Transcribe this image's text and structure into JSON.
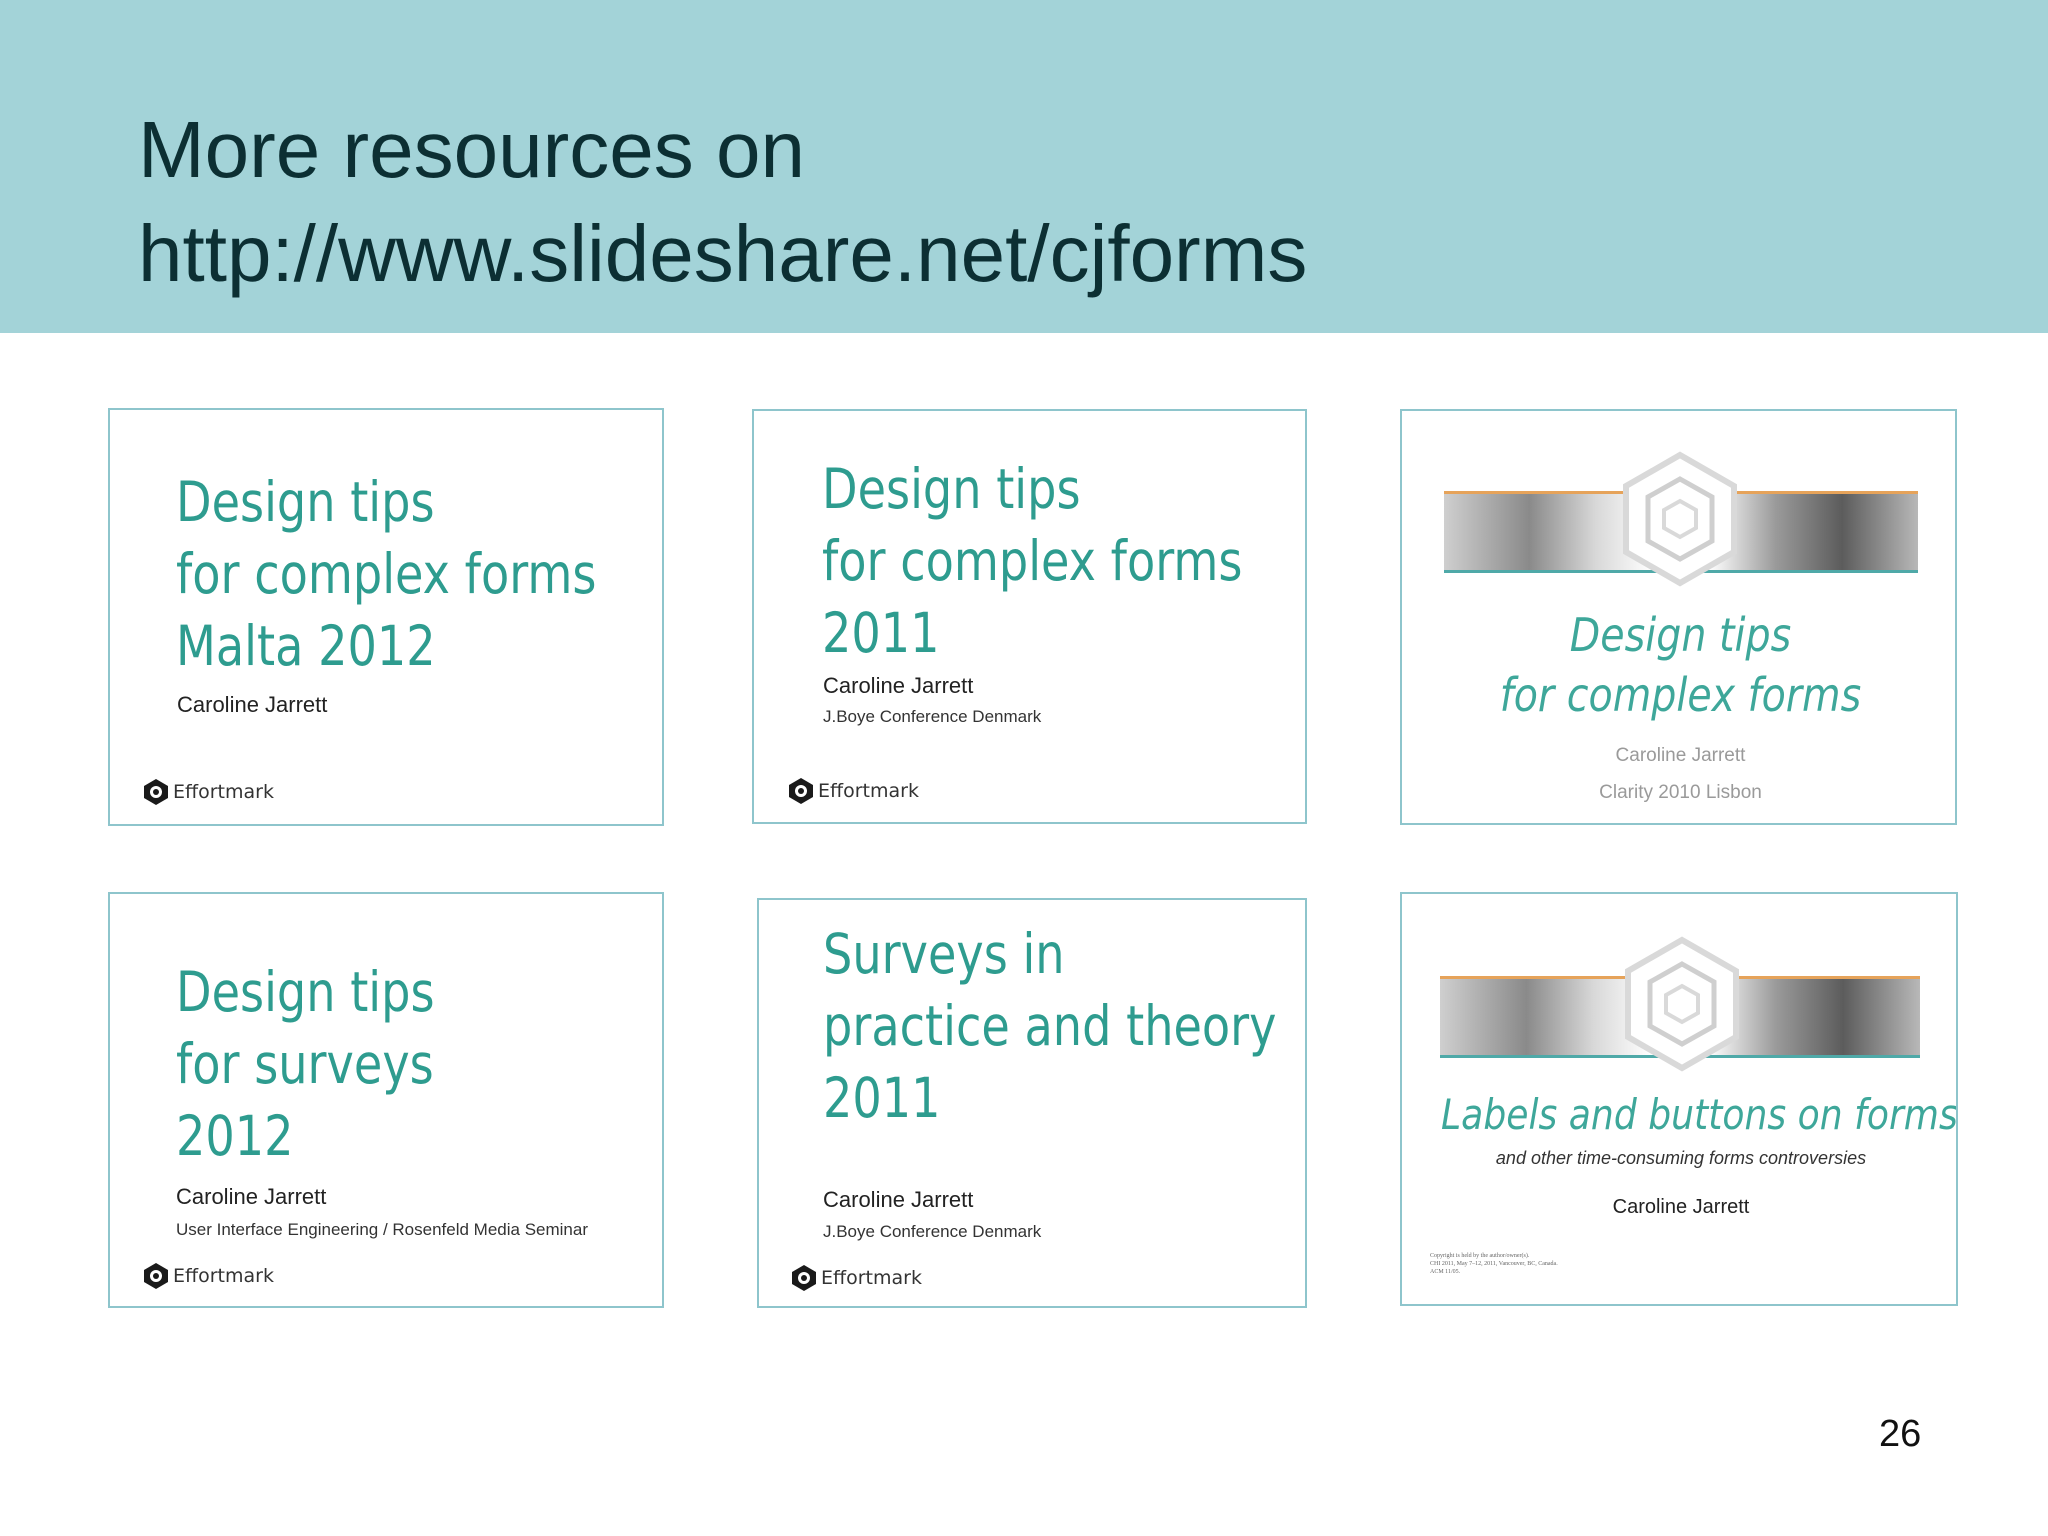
{
  "slide": {
    "title_line1": "More resources on",
    "title_line2": "http://www.slideshare.net/cjforms",
    "page_number": "26"
  },
  "thumbnails": [
    {
      "title_lines": [
        "Design tips",
        "for complex forms",
        "Malta 2012"
      ],
      "author": "Caroline Jarrett",
      "logo": "Effortmark",
      "icon": "effortmark-logo-icon"
    },
    {
      "title_lines": [
        "Design tips",
        "for complex forms",
        "2011"
      ],
      "author": "Caroline Jarrett",
      "event": "J.Boye Conference Denmark",
      "logo": "Effortmark",
      "icon": "effortmark-logo-icon"
    },
    {
      "title_lines": [
        "Design tips",
        "for complex forms"
      ],
      "author": "Caroline Jarrett",
      "event": "Clarity 2010 Lisbon",
      "icon": "hexagon-logo-icon"
    },
    {
      "title_lines": [
        "Design tips",
        "for surveys",
        "2012"
      ],
      "author": "Caroline Jarrett",
      "event": "User Interface Engineering / Rosenfeld Media Seminar",
      "logo": "Effortmark",
      "icon": "effortmark-logo-icon"
    },
    {
      "title_lines": [
        "Surveys in",
        "practice and theory",
        "2011"
      ],
      "author": "Caroline Jarrett",
      "event": "J.Boye Conference Denmark",
      "logo": "Effortmark",
      "icon": "effortmark-logo-icon"
    },
    {
      "title": "Labels and buttons on forms",
      "subtitle": "and other time-consuming forms controversies",
      "author": "Caroline Jarrett",
      "fine_print": [
        "Copyright is held by the author/owner(s).",
        "CHI 2011, May 7–12, 2011, Vancouver, BC, Canada.",
        "ACM 11/05."
      ],
      "icon": "hexagon-logo-icon"
    }
  ],
  "colors": {
    "header_bg": "#a3d3d8",
    "title_text": "#0c2f33",
    "thumb_title": "#2e9c8f",
    "thumb_border": "#8ec5cc"
  }
}
